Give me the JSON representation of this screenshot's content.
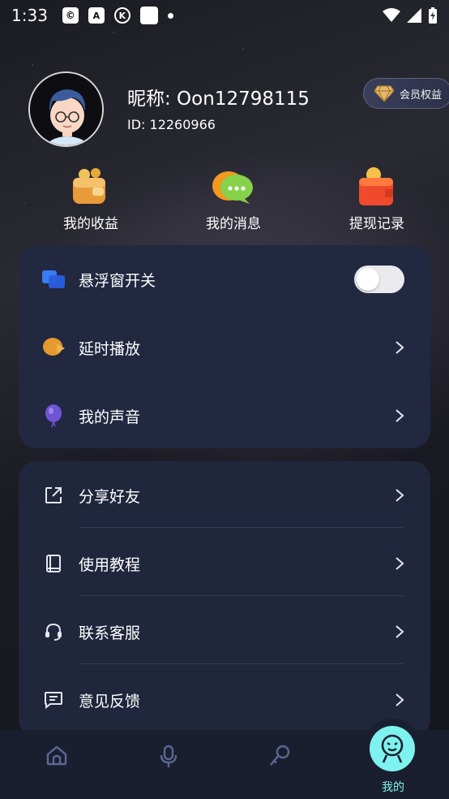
{
  "status_bar": {
    "time": "1:33"
  },
  "profile": {
    "nickname": "昵称: Oon12798115",
    "id": "ID: 12260966",
    "vip_label": "会员权益"
  },
  "quick_actions": [
    {
      "label": "我的收益",
      "icon": "wallet-coins-icon"
    },
    {
      "label": "我的消息",
      "icon": "message-bubble-icon"
    },
    {
      "label": "提现记录",
      "icon": "withdraw-wallet-icon"
    }
  ],
  "settings_card": {
    "items": [
      {
        "label": "悬浮窗开关",
        "icon": "floating-window-icon",
        "toggle_on": false
      },
      {
        "label": "延时播放",
        "icon": "delay-play-icon"
      },
      {
        "label": "我的声音",
        "icon": "voice-balloon-icon"
      }
    ]
  },
  "menu_card": {
    "items": [
      {
        "label": "分享好友",
        "icon": "share-icon"
      },
      {
        "label": "使用教程",
        "icon": "book-icon"
      },
      {
        "label": "联系客服",
        "icon": "headset-icon"
      },
      {
        "label": "意见反馈",
        "icon": "feedback-icon"
      }
    ]
  },
  "bottom_nav": {
    "items": [
      {
        "icon": "home-icon"
      },
      {
        "icon": "microphone-icon"
      },
      {
        "icon": "karaoke-mic-icon"
      },
      {
        "label": "我的",
        "icon": "profile-face-icon",
        "active": true
      }
    ]
  },
  "colors": {
    "accent": "#7ef2ee",
    "card_bg": "#222840",
    "nav_bg": "#1a1f30"
  }
}
